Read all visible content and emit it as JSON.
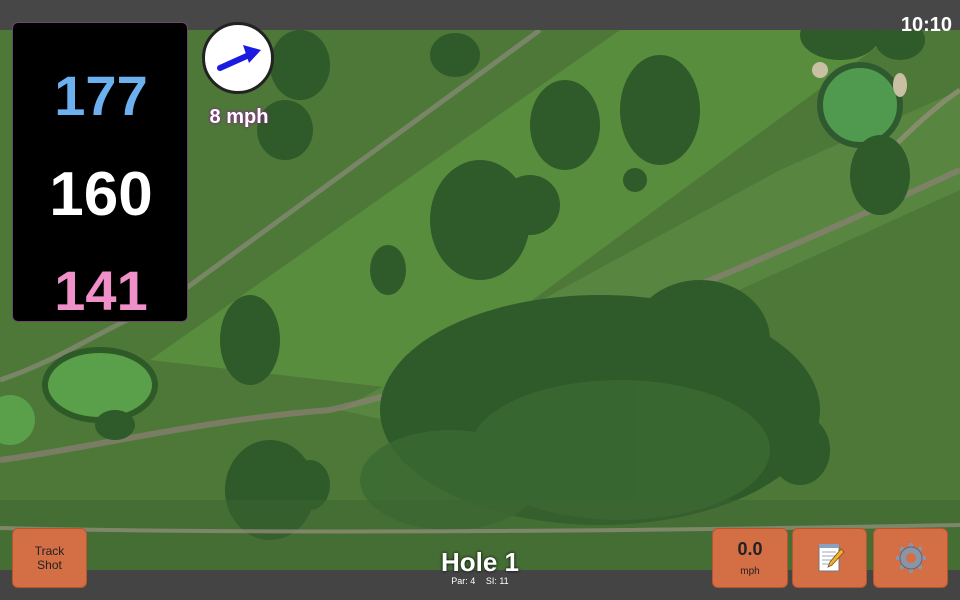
{
  "status": {
    "time": "10:10"
  },
  "distances": {
    "back": "177",
    "middle": "160",
    "front": "141"
  },
  "wind": {
    "speed_label": "8 mph",
    "icon": "wind-arrow-icon"
  },
  "hole": {
    "title": "Hole 1",
    "par": "Par: 4",
    "stroke_index": "SI: 11"
  },
  "buttons": {
    "track_shot_line1": "Track",
    "track_shot_line2": "Shot",
    "speed_value": "0.0",
    "speed_unit": "mph",
    "notes_icon": "notepad-icon",
    "settings_icon": "gear-icon"
  },
  "colors": {
    "back_distance": "#6cb0f0",
    "middle_distance": "#ffffff",
    "front_distance": "#f090c8",
    "button": "#d36e45",
    "wind_arrow": "#1a1ae0"
  }
}
